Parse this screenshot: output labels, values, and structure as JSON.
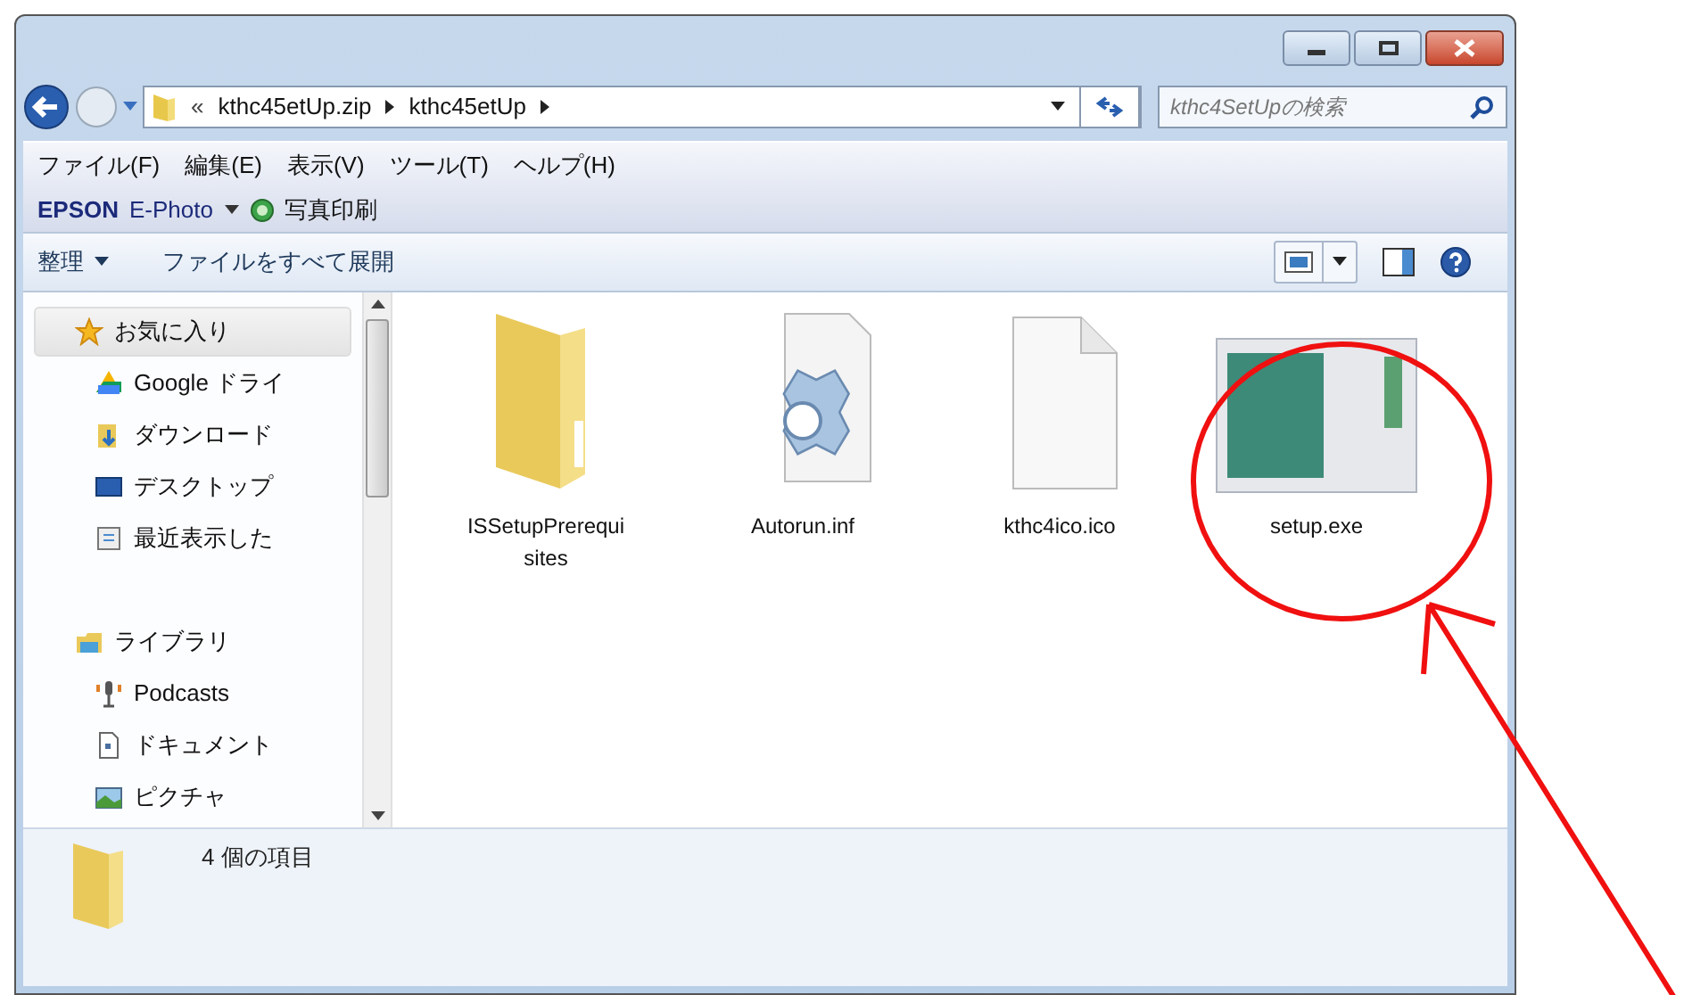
{
  "address_bar": {
    "overflow": "«",
    "crumbs": [
      "kthc45etUp.zip",
      "kthc45etUp"
    ]
  },
  "search": {
    "placeholder": "kthc4SetUpの検索"
  },
  "menu_bar": [
    "ファイル(F)",
    "編集(E)",
    "表示(V)",
    "ツール(T)",
    "ヘルプ(H)"
  ],
  "epson_bar": {
    "brand": "EPSON",
    "product": "E-Photo",
    "action": "写真印刷"
  },
  "command_bar": [
    {
      "label": "整理",
      "kind": "dropdown"
    },
    {
      "label": "ファイルをすべて展開",
      "kind": "plain"
    }
  ],
  "sidebar": {
    "groups": [
      {
        "label": "お気に入り",
        "kind": "star",
        "selected": true,
        "children": [
          {
            "label": "Google ドライ",
            "kind": "drive",
            "selected": false
          },
          {
            "label": "ダウンロード",
            "kind": "download",
            "selected": false
          },
          {
            "label": "デスクトップ",
            "kind": "desktop",
            "selected": false
          },
          {
            "label": "最近表示した",
            "kind": "recent",
            "selected": false
          }
        ]
      },
      {
        "label": "ライブラリ",
        "kind": "library",
        "selected": false,
        "children": [
          {
            "label": "Podcasts",
            "kind": "podcast",
            "selected": false
          },
          {
            "label": "ドキュメント",
            "kind": "document",
            "selected": false
          },
          {
            "label": "ピクチャ",
            "kind": "picture",
            "selected": false
          }
        ]
      }
    ]
  },
  "files": [
    {
      "name": "ISSetupPrerequisites",
      "kind": "folder"
    },
    {
      "name": "Autorun.inf",
      "kind": "config"
    },
    {
      "name": "kthc4ico.ico",
      "kind": "file"
    },
    {
      "name": "setup.exe",
      "kind": "exe"
    }
  ],
  "status_bar": {
    "text": "4 個の項目"
  }
}
